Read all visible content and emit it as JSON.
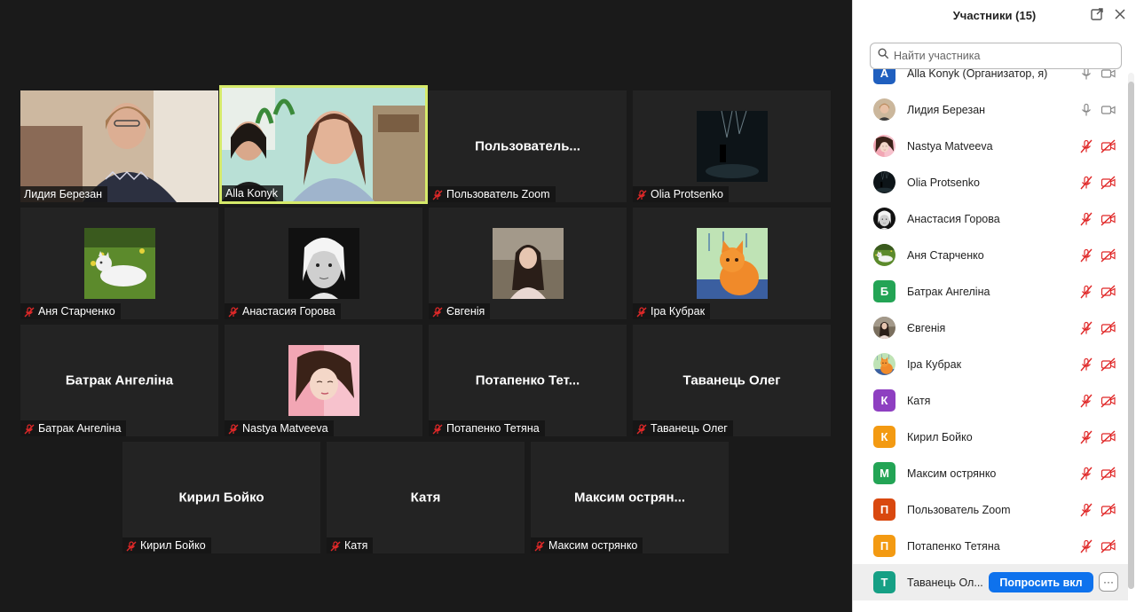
{
  "gallery": {
    "tiles": [
      {
        "name": "Лидия Березан",
        "muted": false,
        "kind": "video-lydia"
      },
      {
        "name": "Alla Konyk",
        "muted": false,
        "kind": "video-alla",
        "speaking": true
      },
      {
        "name": "Пользователь Zoom",
        "big": "Пользователь...",
        "muted": true
      },
      {
        "name": "Olia Protsenko",
        "muted": true,
        "kind": "photo-night"
      },
      {
        "name": "Аня Старченко",
        "muted": true,
        "kind": "photo-cat"
      },
      {
        "name": "Анастасия Горова",
        "muted": true,
        "kind": "photo-bw"
      },
      {
        "name": "Євгенія",
        "muted": true,
        "kind": "photo-girl"
      },
      {
        "name": "Іра Кубрак",
        "muted": true,
        "kind": "photo-foxcat"
      },
      {
        "name": "Батрак Ангеліна",
        "big": "Батрак Ангеліна",
        "muted": true
      },
      {
        "name": "Nastya Matveeva",
        "muted": true,
        "kind": "photo-pink"
      },
      {
        "name": "Потапенко Тетяна",
        "big": "Потапенко  Тет...",
        "muted": true
      },
      {
        "name": "Таванець Олег",
        "big": "Таванець Олег",
        "muted": true
      },
      {
        "name": "Кирил Бойко",
        "big": "Кирил Бойко",
        "muted": true
      },
      {
        "name": "Катя",
        "big": "Катя",
        "muted": true
      },
      {
        "name": "Максим острянко",
        "big": "Максим  острян...",
        "muted": true
      }
    ]
  },
  "panel": {
    "title": "Участники (15)",
    "search_placeholder": "Найти участника",
    "ask_button": "Попросить вкл",
    "more_button": "···",
    "participants": [
      {
        "name": "Alla Konyk (Организатор, я)",
        "initial": "A",
        "color": "#1f5fbf",
        "mic": "on",
        "cam": "on"
      },
      {
        "name": "Лидия Березан",
        "photo": "lydia",
        "mic": "on",
        "cam": "on"
      },
      {
        "name": "Nastya Matveeva",
        "photo": "pink",
        "mic": "off",
        "cam": "off"
      },
      {
        "name": "Olia Protsenko",
        "photo": "night",
        "mic": "off",
        "cam": "off"
      },
      {
        "name": "Анастасия Горова",
        "photo": "bw",
        "mic": "off",
        "cam": "off"
      },
      {
        "name": "Аня Старченко",
        "photo": "cat",
        "mic": "off",
        "cam": "off"
      },
      {
        "name": "Батрак Ангеліна",
        "initial": "Б",
        "color": "#23a455",
        "mic": "off",
        "cam": "off"
      },
      {
        "name": "Євгенія",
        "photo": "girl",
        "mic": "off",
        "cam": "off"
      },
      {
        "name": "Іра Кубрак",
        "photo": "foxcat",
        "mic": "off",
        "cam": "off"
      },
      {
        "name": "Катя",
        "initial": "К",
        "color": "#8e3fc1",
        "mic": "off",
        "cam": "off"
      },
      {
        "name": "Кирил Бойко",
        "initial": "К",
        "color": "#f39a12",
        "mic": "off",
        "cam": "off"
      },
      {
        "name": "Максим острянко",
        "initial": "М",
        "color": "#23a455",
        "mic": "off",
        "cam": "off"
      },
      {
        "name": "Пользователь Zoom",
        "initial": "П",
        "color": "#d9480f",
        "mic": "off",
        "cam": "off"
      },
      {
        "name": "Потапенко Тетяна",
        "initial": "П",
        "color": "#f39a12",
        "mic": "off",
        "cam": "off"
      },
      {
        "name": "Таванець Ол...",
        "initial": "Т",
        "color": "#16a085",
        "mic": "",
        "cam": "",
        "hover": true
      }
    ]
  }
}
